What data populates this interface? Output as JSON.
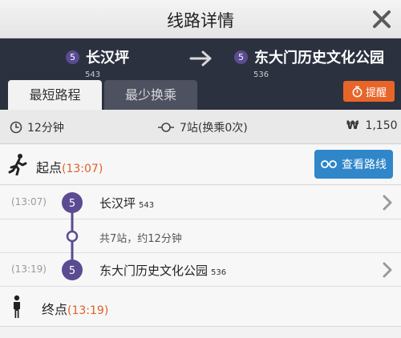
{
  "title_bar": {
    "title": "线路详情",
    "close_icon": "close-icon"
  },
  "route": {
    "from": {
      "line": "5",
      "name": "长汉坪",
      "code": "543"
    },
    "to": {
      "line": "5",
      "name": "东大门历史文化公园",
      "code": "536"
    },
    "arrow_icon": "arrow-right-icon"
  },
  "tabs": [
    {
      "label": "最短路程",
      "active": true
    },
    {
      "label": "最少换乘",
      "active": false
    }
  ],
  "remind_button": {
    "label": "提醒",
    "icon": "stopwatch-icon"
  },
  "summary": {
    "duration": "12分钟",
    "stations": "7站(换乘0次)",
    "fare_symbol": "₩",
    "fare": "1,150"
  },
  "start": {
    "label": "起点",
    "time": "(13:07)",
    "view_route_label": "查看路线",
    "icon": "walking-person-icon"
  },
  "stops": [
    {
      "time": "(13:07)",
      "line": "5",
      "name": "长汉坪",
      "code": "543"
    },
    {
      "time": "(13:19)",
      "line": "5",
      "name": "东大门历史文化公园",
      "code": "536"
    }
  ],
  "middle_info": "共7站，约12分钟",
  "end": {
    "label": "终点",
    "time": "(13:19)",
    "icon": "standing-person-icon"
  },
  "colors": {
    "line5": "#5b4b92",
    "accent_orange": "#e8652a",
    "button_blue": "#2f86c9",
    "header_dark": "#2c3140"
  }
}
